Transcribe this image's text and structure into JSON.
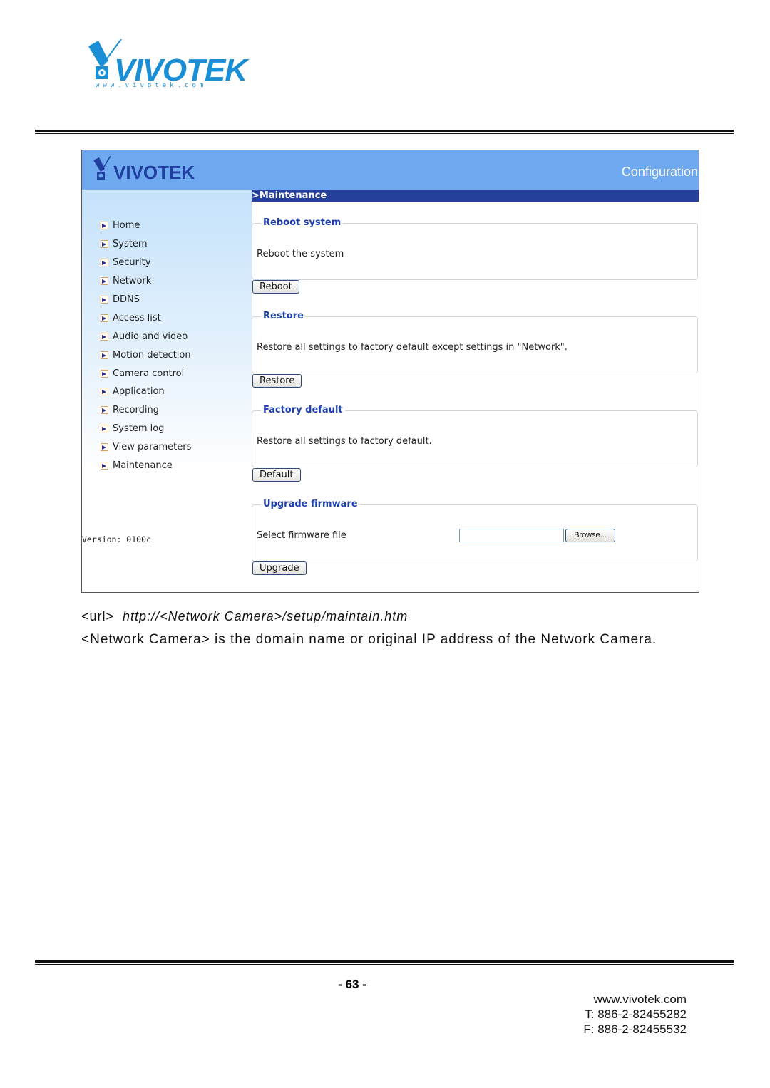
{
  "brand": {
    "name": "VIVOTEK",
    "url_text": "www.vivotek.com",
    "color": "#1a8fd6"
  },
  "app": {
    "logo_text": "VIVOTEK",
    "header_label": "Configuration",
    "page_title": ">Maintenance",
    "sidebar": {
      "items": [
        {
          "label": "Home"
        },
        {
          "label": "System"
        },
        {
          "label": "Security"
        },
        {
          "label": "Network"
        },
        {
          "label": "DDNS"
        },
        {
          "label": "Access list"
        },
        {
          "label": "Audio and video"
        },
        {
          "label": "Motion detection"
        },
        {
          "label": "Camera control"
        },
        {
          "label": "Application"
        },
        {
          "label": "Recording"
        },
        {
          "label": "System log"
        },
        {
          "label": "View parameters"
        },
        {
          "label": "Maintenance"
        }
      ],
      "version": "Version: 0100c"
    },
    "sections": {
      "reboot": {
        "legend": "Reboot system",
        "text": "Reboot the system",
        "button": "Reboot"
      },
      "restore": {
        "legend": "Restore",
        "text": "Restore all settings to factory default except settings in \"Network\".",
        "button": "Restore"
      },
      "factory": {
        "legend": "Factory default",
        "text": "Restore all settings to factory default.",
        "button": "Default"
      },
      "upgrade": {
        "legend": "Upgrade firmware",
        "text": "Select firmware file",
        "file_value": "",
        "browse": "Browse...",
        "button": "Upgrade"
      }
    },
    "colors": {
      "header": "#6ea9ef",
      "titlebar": "#25409a",
      "legend": "#1e3fb0"
    }
  },
  "caption": {
    "url_label": "<url>",
    "url_value": "http://<Network Camera>/setup/maintain.htm",
    "note": "<Network Camera> is the domain name or original IP address of the Network Camera."
  },
  "footer": {
    "page_number": "- 63 -",
    "website": "www.vivotek.com",
    "phone": "T: 886-2-82455282",
    "fax": "F: 886-2-82455532"
  }
}
